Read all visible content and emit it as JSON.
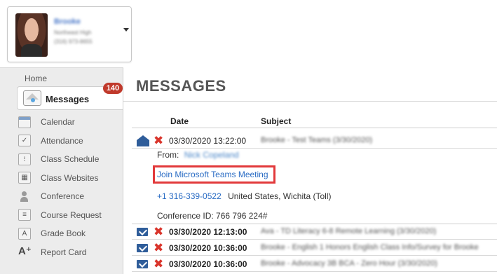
{
  "user": {
    "name": "Brooke",
    "line1": "Northeast High",
    "line2": "(316) 973-8655"
  },
  "nav": {
    "home": "Home",
    "messages": {
      "label": "Messages",
      "badge": "140"
    },
    "items": [
      {
        "label": "Calendar",
        "icon": "calendar-icon"
      },
      {
        "label": "Attendance",
        "icon": "attendance-icon"
      },
      {
        "label": "Class Schedule",
        "icon": "schedule-icon"
      },
      {
        "label": "Class Websites",
        "icon": "websites-icon"
      },
      {
        "label": "Conference",
        "icon": "person-icon"
      },
      {
        "label": "Course Request",
        "icon": "request-icon"
      },
      {
        "label": "Grade Book",
        "icon": "gradebook-icon"
      },
      {
        "label": "Report Card",
        "icon": "report-card-icon"
      }
    ]
  },
  "main": {
    "title": "MESSAGES",
    "columns": {
      "date": "Date",
      "subject": "Subject"
    },
    "open_message": {
      "date": "03/30/2020 13:22:00",
      "subject": "Brooke - Test Teams (3/30/2020)",
      "from_label": "From:",
      "from_name": "Nick Copeland",
      "teams_link": "Join Microsoft Teams Meeting",
      "phone": "+1 316-339-0522",
      "phone_location": "United States, Wichita (Toll)",
      "conference_id": "Conference ID: 766 796 224#"
    },
    "messages": [
      {
        "date": "03/30/2020 12:13:00",
        "subject": "Ava - TD Literacy 6-8 Remote Learning (3/30/2020)"
      },
      {
        "date": "03/30/2020 10:36:00",
        "subject": "Brooke - English 1 Honors English Class Info/Survey for Brooke"
      },
      {
        "date": "03/30/2020 10:36:00",
        "subject": "Brooke - Advocacy 3B BCA - Zero Hour (3/30/2020)"
      }
    ]
  },
  "colors": {
    "accent_blue": "#2a6cc4",
    "badge_red": "#c0392b",
    "highlight_red": "#e2393b",
    "sidebar_bg": "#ececec"
  }
}
